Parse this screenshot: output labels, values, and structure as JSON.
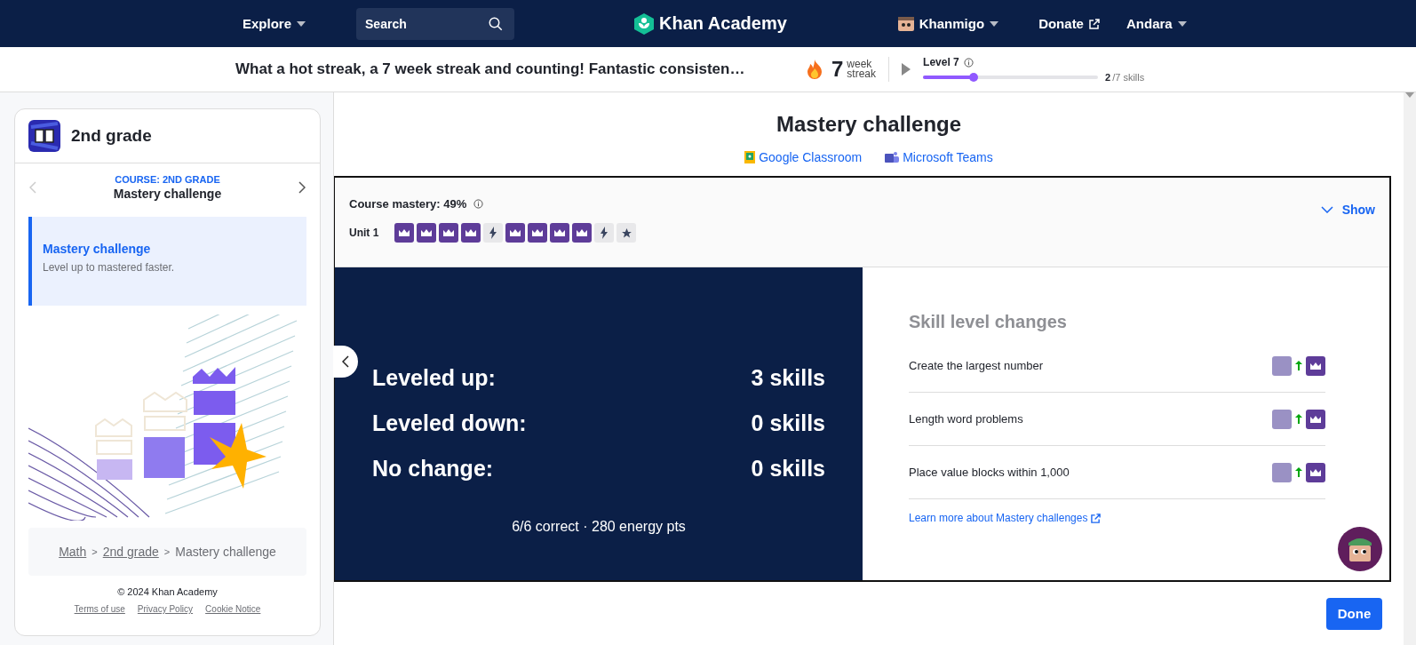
{
  "header": {
    "explore": "Explore",
    "search": {
      "placeholder": "Search"
    },
    "logo": "Khan Academy",
    "khanmigo": "Khanmigo",
    "donate": "Donate",
    "user": "Andara"
  },
  "streak_bar": {
    "message": "What a hot streak, a 7 week streak and counting! Fantastic consisten…",
    "streak_count": "7",
    "streak_unit_top": "week",
    "streak_unit_bottom": "streak",
    "level_label": "Level 7",
    "level": 0.29,
    "skills_done": "2",
    "skills_total": "/7 skills"
  },
  "sidebar": {
    "course_title": "2nd grade",
    "course_label": "COURSE: 2ND GRADE",
    "lesson_title": "Mastery challenge",
    "items": [
      {
        "title": "Mastery challenge",
        "subtitle": "Level up to mastered faster.",
        "selected": true
      }
    ],
    "breadcrumbs": [
      {
        "label": "Math",
        "kind": "link"
      },
      {
        "separator": ">",
        "label": "2nd grade",
        "kind": "link"
      },
      {
        "separator": ">",
        "label": "Mastery challenge",
        "kind": "current"
      }
    ],
    "copyright": "© 2024 Khan Academy",
    "footer_links": [
      "Terms of use",
      "Privacy Policy",
      "Cookie Notice"
    ]
  },
  "main": {
    "title": "Mastery challenge",
    "share_links": [
      {
        "label": "Google Classroom",
        "kind": "classroom"
      },
      {
        "label": "Microsoft Teams",
        "kind": "teams"
      }
    ],
    "mastery": {
      "label": "Course mastery: 49%",
      "toggle": "Show",
      "units": [
        {
          "name": "Unit 1",
          "skills": [
            {
              "kind": "mastered"
            },
            {
              "kind": "mastered"
            },
            {
              "kind": "mastered"
            },
            {
              "kind": "mastered"
            },
            {
              "kind": "quiz"
            },
            {
              "kind": "mastered"
            },
            {
              "kind": "mastered"
            },
            {
              "kind": "mastered"
            },
            {
              "kind": "mastered"
            },
            {
              "kind": "quiz"
            },
            {
              "kind": "test"
            }
          ]
        }
      ]
    },
    "summary": {
      "rows": [
        {
          "label": "Leveled up:",
          "value": "3 skills"
        },
        {
          "label": "Leveled down:",
          "value": "0 skills"
        },
        {
          "label": "No change:",
          "value": "0 skills"
        }
      ],
      "footer": "6/6 correct · 280 energy pts"
    },
    "skill_changes": {
      "title": "Skill level changes",
      "items": [
        {
          "name": "Create the largest number",
          "levels": [
            {
              "kind": "proficient"
            },
            {
              "kind": "mastered"
            }
          ]
        },
        {
          "name": "Length word problems",
          "levels": [
            {
              "kind": "proficient"
            },
            {
              "kind": "mastered"
            }
          ]
        },
        {
          "name": "Place value blocks within 1,000",
          "levels": [
            {
              "kind": "proficient"
            },
            {
              "kind": "mastered"
            }
          ]
        }
      ],
      "link": "Learn more about Mastery challenges"
    },
    "done": "Done"
  }
}
